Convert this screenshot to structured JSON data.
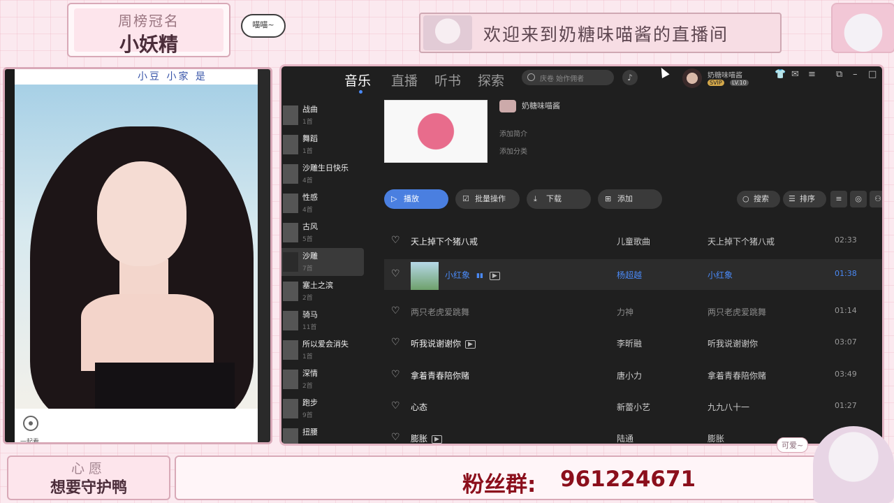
{
  "overlay": {
    "rank_title": "周榜冠名",
    "rank_name": "小妖精",
    "bubble_text": "喵喵~",
    "welcome_text": "欢迎来到奶糖味喵酱的直播间",
    "video_topline": "小豆 小家 是",
    "watch_together_label": "一起看",
    "wish_title": "心愿",
    "wish_text": "想要守护鸭",
    "fan_group_label": "粉丝群:",
    "fan_group_number": "961224671",
    "cute_label": "可爱~"
  },
  "app": {
    "tabs": [
      "音乐",
      "直播",
      "听书",
      "探索"
    ],
    "active_tab": "音乐",
    "search_placeholder": "庆卷 始作佣者",
    "user": {
      "name": "奶糖味喵酱",
      "svip": "SVIP",
      "level": "LV.10"
    },
    "window_icons": [
      "shirt-icon",
      "mail-icon",
      "menu-icon",
      "minimize-icon",
      "maximize-icon"
    ],
    "playlists": [
      {
        "name": "战曲",
        "count": "1首"
      },
      {
        "name": "舞蹈",
        "count": "1首"
      },
      {
        "name": "沙雕生日快乐",
        "count": "4首"
      },
      {
        "name": "性感",
        "count": "4首"
      },
      {
        "name": "古风",
        "count": "5首"
      },
      {
        "name": "沙雕",
        "count": "7首",
        "active": true
      },
      {
        "name": "塞土之滨",
        "count": "2首"
      },
      {
        "name": "骑马",
        "count": "11首"
      },
      {
        "name": "所以爱会消失",
        "count": "1首"
      },
      {
        "name": "深情",
        "count": "2首"
      },
      {
        "name": "跑步",
        "count": "9首"
      },
      {
        "name": "扭腰",
        "count": ""
      }
    ],
    "album": {
      "owner": "奶糖味喵酱",
      "add_intro": "添加简介",
      "add_category": "添加分类"
    },
    "toolbar": {
      "play": "播放",
      "batch": "批量操作",
      "download": "下载",
      "add": "添加",
      "search": "搜索",
      "sort": "排序"
    },
    "songs": [
      {
        "title": "天上掉下个猪八戒",
        "artist": "儿童歌曲",
        "album": "天上掉下个猪八戒",
        "duration": "02:33",
        "mv": false
      },
      {
        "title": "小红象",
        "artist": "杨超越",
        "album": "小红象",
        "duration": "01:38",
        "mv": true,
        "active": true
      },
      {
        "title": "两只老虎爱跳舞",
        "artist": "力神",
        "album": "两只老虎爱跳舞",
        "duration": "01:14",
        "mv": false,
        "dim": true
      },
      {
        "title": "听我说谢谢你",
        "artist": "李昕融",
        "album": "听我说谢谢你",
        "duration": "03:07",
        "mv": true
      },
      {
        "title": "拿着青春陪你赌",
        "artist": "唐小力",
        "album": "拿着青春陪你赌",
        "duration": "03:49",
        "mv": false
      },
      {
        "title": "心态",
        "artist": "新蕾小艺",
        "album": "九九八十一",
        "duration": "01:27",
        "mv": false
      },
      {
        "title": "膨胀",
        "artist": "陆通",
        "album": "膨胀",
        "duration": "",
        "mv": true
      }
    ]
  },
  "colors": {
    "accent": "#4a89f5",
    "play_button": "#4a7fe0",
    "fan_text": "#8b0f1c",
    "frame_pink": "#e6b7c6"
  }
}
